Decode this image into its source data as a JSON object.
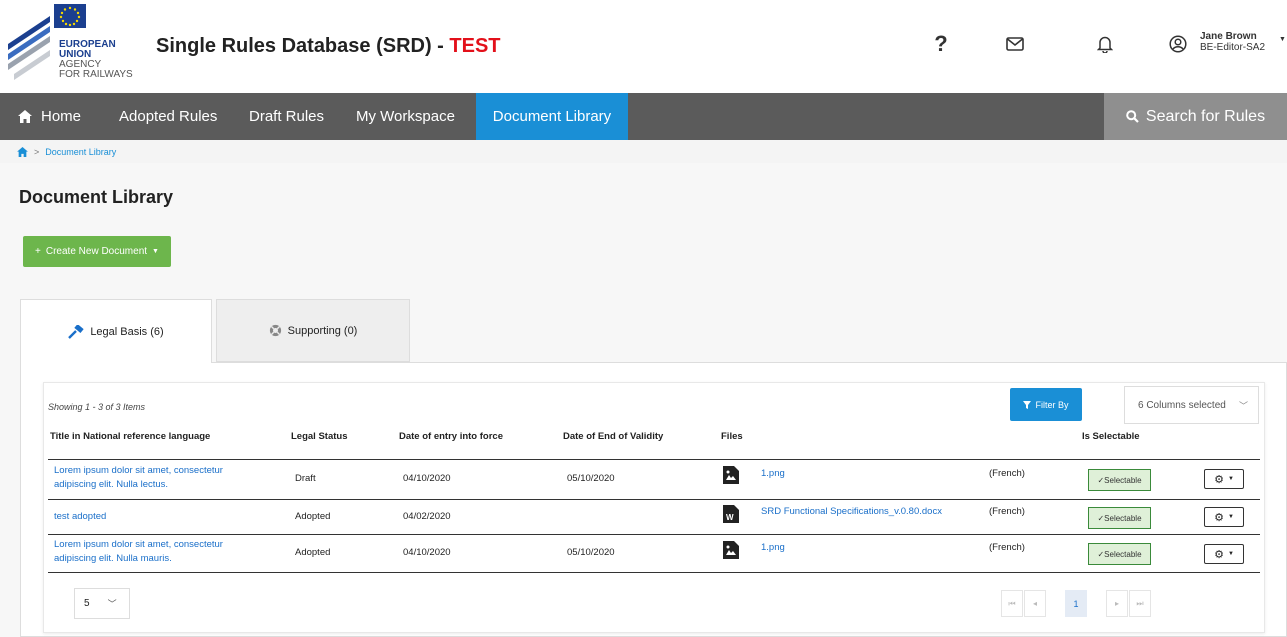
{
  "logo": {
    "line1": "EUROPEAN",
    "line2": "UNION",
    "line3": "AGENCY",
    "line4": "FOR RAILWAYS"
  },
  "header": {
    "title": "Single Rules Database (SRD) - ",
    "env": "TEST",
    "help": "?",
    "user_name": "Jane Brown",
    "user_role": "BE-Editor-SA2"
  },
  "nav": {
    "home": "Home",
    "adopted": "Adopted Rules",
    "draft": "Draft Rules",
    "workspace": "My Workspace",
    "doclib": "Document Library",
    "search": "Search for Rules"
  },
  "breadcrumb": {
    "current": "Document Library"
  },
  "page": {
    "title": "Document Library",
    "create_button": "Create New Document"
  },
  "tabs": {
    "legal": "Legal Basis (6)",
    "supporting": "Supporting (0)"
  },
  "grid": {
    "showing": "Showing 1 - 3 of 3 Items",
    "filter_button": "Filter By",
    "columns_selected": "6 Columns selected",
    "headers": {
      "title": "Title in National reference language",
      "status": "Legal Status",
      "entry": "Date of entry into force",
      "end": "Date of End of Validity",
      "files": "Files",
      "selectable": "Is Selectable"
    },
    "rows": [
      {
        "title_line1": "Lorem ipsum dolor sit amet, consectetur",
        "title_line2": "adipiscing elit. Nulla lectus.",
        "status": "Draft",
        "entry": "04/10/2020",
        "end": "05/10/2020",
        "file": "1.png",
        "lang": "(French)",
        "selectable": "Selectable"
      },
      {
        "title_line1": "test adopted",
        "title_line2": "",
        "status": "Adopted",
        "entry": "04/02/2020",
        "end": "",
        "file": "SRD Functional Specifications_v.0.80.docx",
        "lang": "(French)",
        "selectable": "Selectable"
      },
      {
        "title_line1": "Lorem ipsum dolor sit amet, consectetur",
        "title_line2": "adipiscing elit. Nulla mauris.",
        "status": "Adopted",
        "entry": "04/10/2020",
        "end": "05/10/2020",
        "file": "1.png",
        "lang": "(French)",
        "selectable": "Selectable"
      }
    ],
    "page_size": "5",
    "current_page": "1"
  },
  "colors": {
    "navbar": "#5b5b5b",
    "nav_active": "#1a8fd6",
    "search": "#8f8f8f",
    "create_button": "#6db64c",
    "filter_button": "#1a8fd6",
    "env_red": "#e3101a",
    "selectable_bg": "#dff0d8"
  }
}
